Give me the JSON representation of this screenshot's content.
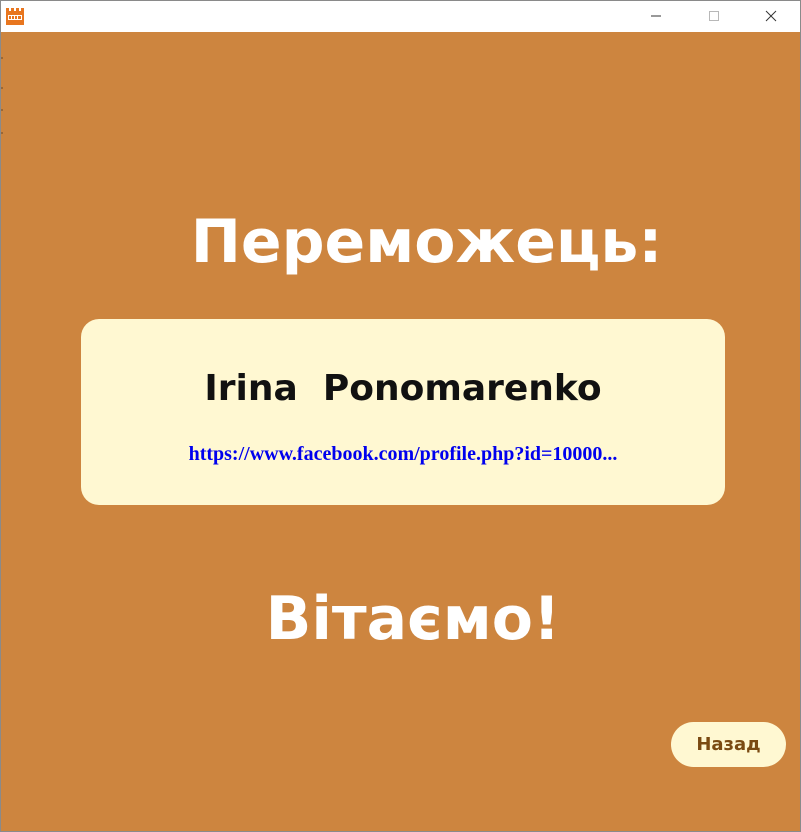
{
  "window": {
    "app_icon": "castle-icon",
    "controls": {
      "minimize": "minimize-icon",
      "maximize": "maximize-icon",
      "close": "close-icon"
    }
  },
  "main": {
    "title": "Переможець:",
    "winner": {
      "name": "Irina  Ponomarenko",
      "link": "https://www.facebook.com/profile.php?id=10000..."
    },
    "greeting": "Вітаємо!",
    "back_label": "Назад"
  },
  "colors": {
    "background": "#cd853f",
    "card": "#fff8d2",
    "link": "#0000ee",
    "title_text": "#ffffff",
    "button_text": "#7a4a12"
  }
}
